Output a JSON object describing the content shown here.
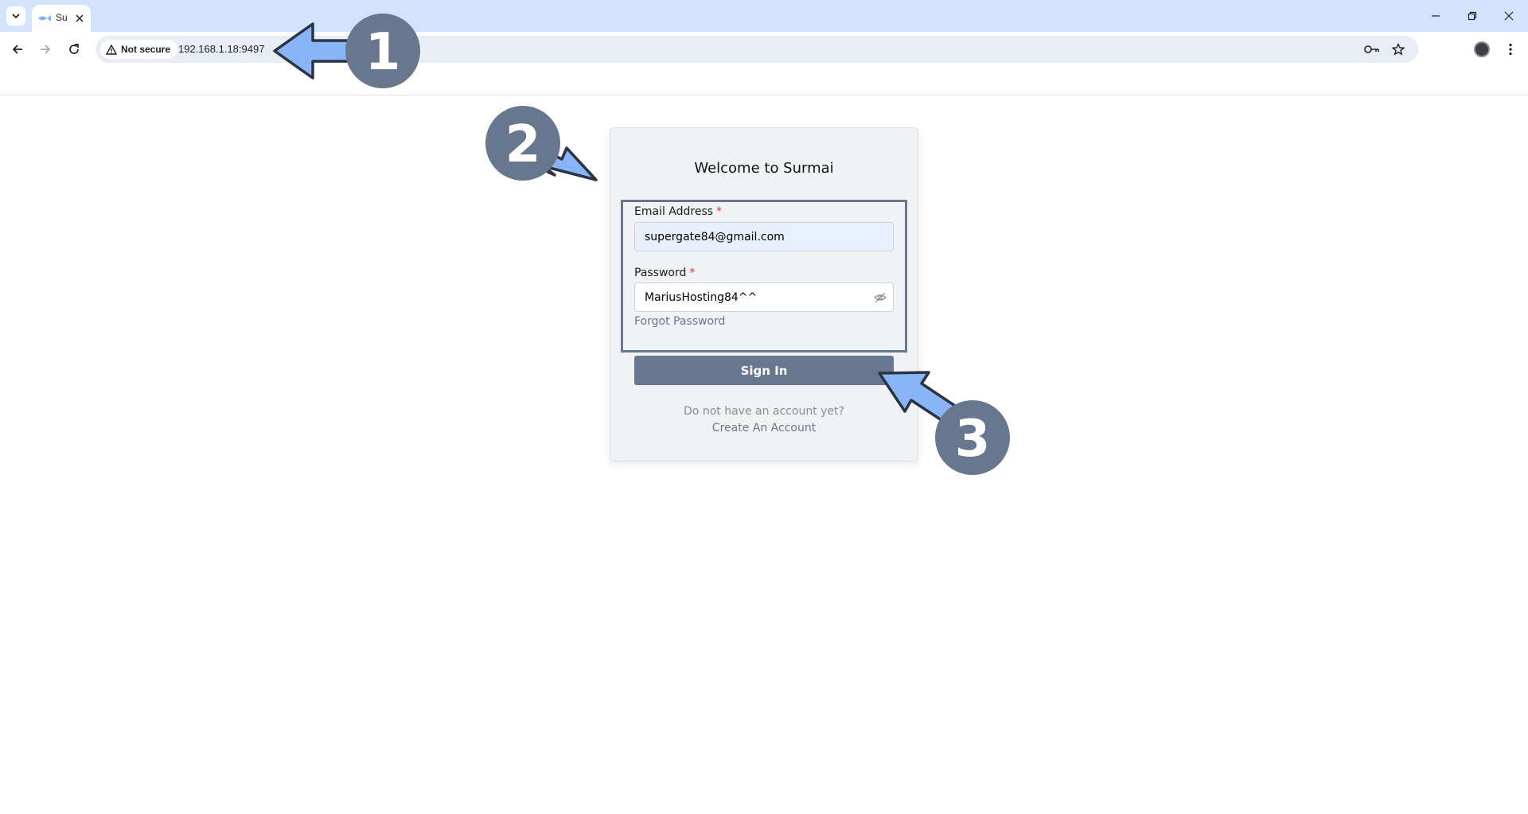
{
  "browser": {
    "tab_title": "Su",
    "security_label": "Not secure",
    "url": "192.168.1.18:9497"
  },
  "login": {
    "title": "Welcome to Surmai",
    "email_label": "Email Address",
    "email_value": "supergate84@gmail.com",
    "password_label": "Password",
    "password_value": "MariusHosting84^^",
    "required_mark": "*",
    "forgot_label": "Forgot Password",
    "signin_label": "Sign In",
    "no_account_text": "Do not have an account yet?",
    "create_account_label": "Create An Account"
  },
  "annotations": {
    "step1": "1",
    "step2": "2",
    "step3": "3"
  },
  "colors": {
    "accent": "#68778e",
    "arrow_fill": "#8ab4f8",
    "badge": "#68778e",
    "tabstrip": "#d3e3fd",
    "required": "#e03131"
  }
}
